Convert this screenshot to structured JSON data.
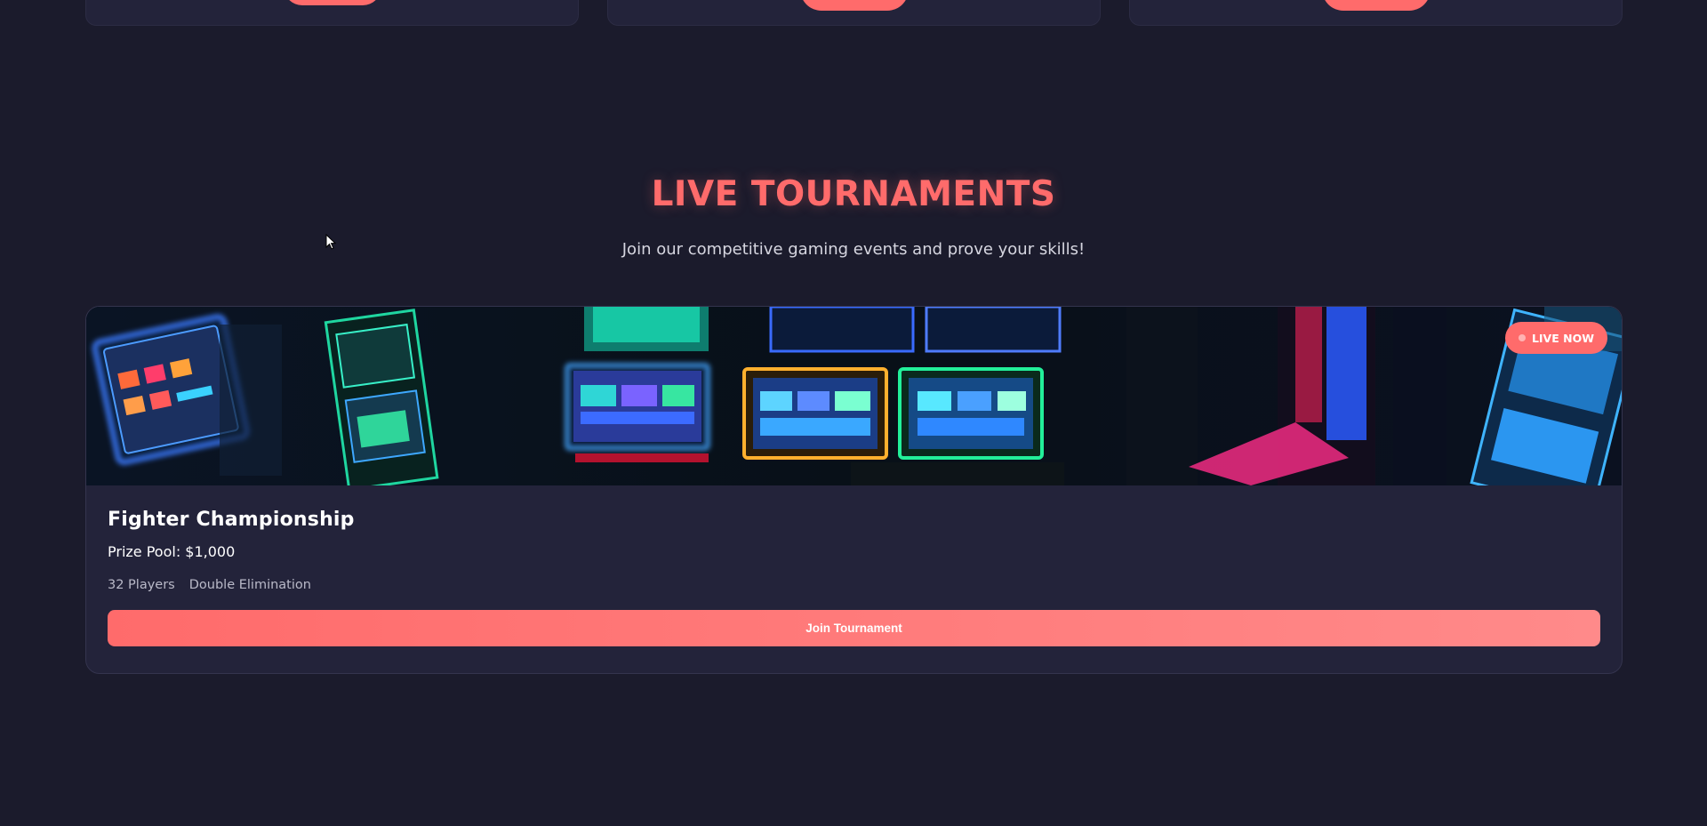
{
  "section": {
    "title": "LIVE TOURNAMENTS",
    "subtitle": "Join our competitive gaming events and prove your skills!"
  },
  "tournament": {
    "badge": "LIVE NOW",
    "name": "Fighter Championship",
    "prize": "Prize Pool: $1,000",
    "players": "32 Players",
    "format": "Double Elimination",
    "join_label": "Join Tournament"
  },
  "colors": {
    "background": "#1b1b2c",
    "card": "#23233a",
    "accent": "#ff6b6b"
  },
  "icons": [
    "live-dot-icon",
    "mouse-cursor-icon"
  ]
}
